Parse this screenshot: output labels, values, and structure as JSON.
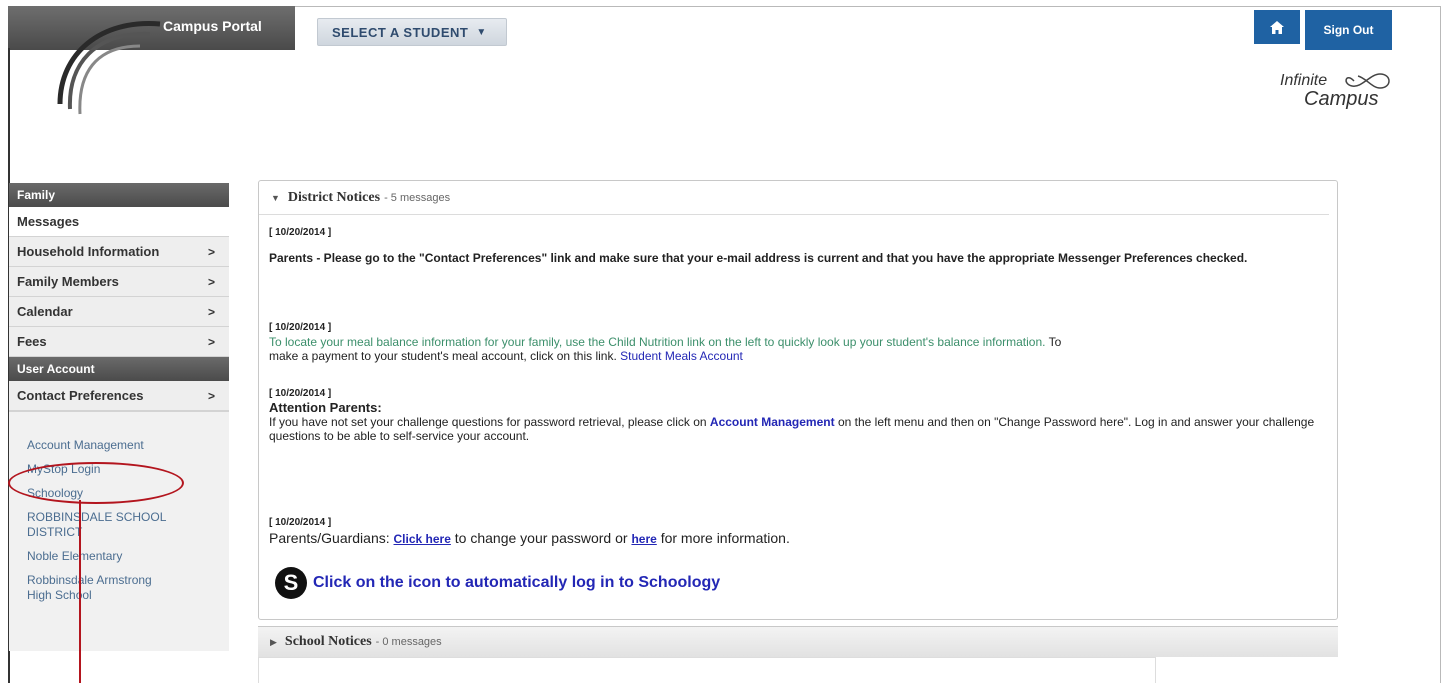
{
  "header": {
    "portal_title": "Campus Portal",
    "select_student": "SELECT A STUDENT",
    "sign_out": "Sign Out",
    "home_icon": "home-icon",
    "logo_line1": "Infinite",
    "logo_line2": "Campus"
  },
  "sidebar": {
    "sections": {
      "family": "Family",
      "user_account": "User Account"
    },
    "family_items": [
      {
        "label": "Messages",
        "arrow": ""
      },
      {
        "label": "Household Information",
        "arrow": ">"
      },
      {
        "label": "Family Members",
        "arrow": ">"
      },
      {
        "label": "Calendar",
        "arrow": ">"
      },
      {
        "label": "Fees",
        "arrow": ">"
      }
    ],
    "user_items": [
      {
        "label": "Contact Preferences",
        "arrow": ">"
      }
    ],
    "links": [
      "Account Management",
      "MyStop Login",
      "Schoology",
      "ROBBINSDALE SCHOOL DISTRICT",
      "Noble Elementary",
      "Robbinsdale Armstrong High School"
    ]
  },
  "district_notices": {
    "title": "District Notices",
    "count": "- 5 messages",
    "m1_date": "[ 10/20/2014 ]",
    "m2_date": "[ 10/20/2014 ]",
    "m2_text": "Parents - Please go to the \"Contact Preferences\" link and make sure that your e-mail address is current and that you have the appropriate Messenger Preferences checked.",
    "m3_date": "[ 10/20/2014 ]",
    "m3_green": "To locate your meal balance information for your family, use the Child Nutrition link on the left to quickly look up your student's balance information.",
    "m3_black_a": " To",
    "m3_black_b": "make a payment to your student's meal account, click on this link.",
    "m3_link": "Student Meals Account",
    "m4_date": "[ 10/20/2014 ]",
    "m4_heading": "Attention Parents:",
    "m4_text_a": "If you have not set your challenge questions for password retrieval, please click on",
    "m4_link": "Account Management",
    "m4_text_b": "on the left menu and then on \"Change Password here\". Log in and answer your challenge questions to be able to self-service your account.",
    "m5_date": "[ 10/20/2014 ]",
    "m5_text_a": "Parents/Guardians:",
    "m5_link1": "Click here",
    "m5_text_b": "to change your password or",
    "m5_link2": "here",
    "m5_text_c": "for more information.",
    "schoology_icon_letter": "S",
    "schoology_text": "Click on the icon to automatically log in to Schoology"
  },
  "school_notices": {
    "title": "School Notices",
    "count": "- 0 messages"
  }
}
